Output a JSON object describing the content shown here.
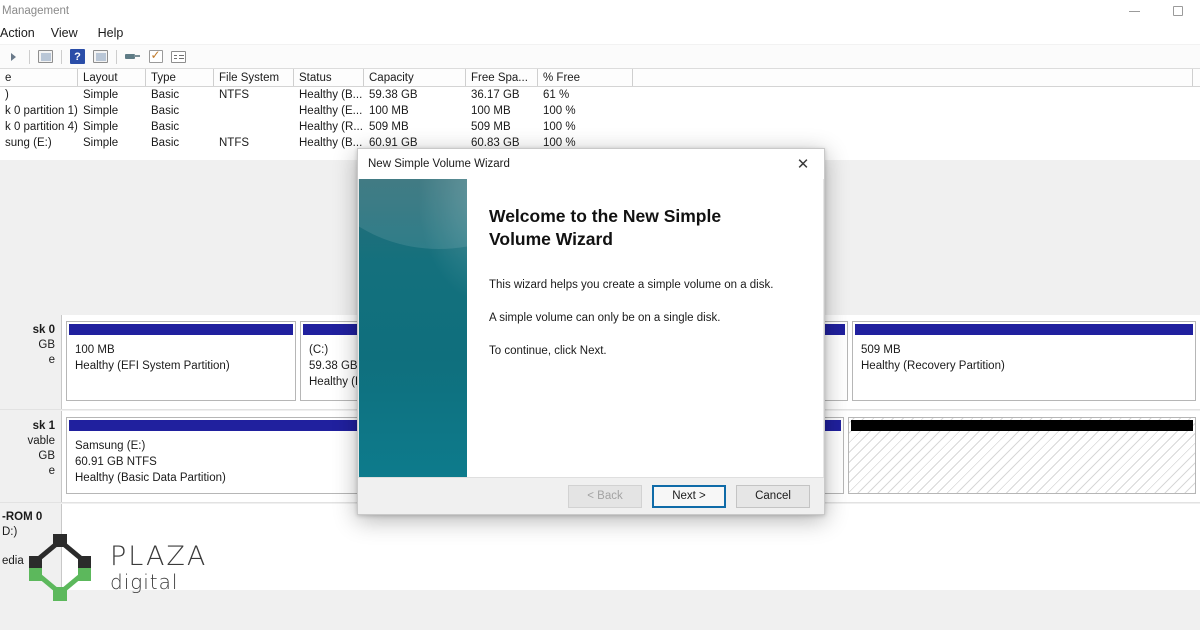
{
  "window": {
    "title": "Management",
    "minimize_label": "Minimize",
    "restore_label": "Restore"
  },
  "menubar": {
    "items": [
      {
        "label": "Action"
      },
      {
        "label": "View"
      },
      {
        "label": "Help"
      }
    ]
  },
  "toolbar": {
    "icons": [
      "forward-arrow-icon",
      "properties-icon",
      "help-icon",
      "rescan-disks-icon",
      "pin-icon",
      "checkmark-icon",
      "list-view-icon"
    ],
    "help_glyph": "?"
  },
  "volume_table": {
    "columns": [
      {
        "key": "volume",
        "label": "e"
      },
      {
        "key": "layout",
        "label": "Layout"
      },
      {
        "key": "type",
        "label": "Type"
      },
      {
        "key": "filesystem",
        "label": "File System"
      },
      {
        "key": "status",
        "label": "Status"
      },
      {
        "key": "capacity",
        "label": "Capacity"
      },
      {
        "key": "freespace",
        "label": "Free Spa..."
      },
      {
        "key": "pctfree",
        "label": "% Free"
      },
      {
        "key": "tail",
        "label": ""
      }
    ],
    "rows": [
      {
        "volume": ")",
        "layout": "Simple",
        "type": "Basic",
        "filesystem": "NTFS",
        "status": "Healthy (B...",
        "capacity": "59.38 GB",
        "freespace": "36.17 GB",
        "pctfree": "61 %"
      },
      {
        "volume": "k 0 partition 1)",
        "layout": "Simple",
        "type": "Basic",
        "filesystem": "",
        "status": "Healthy (E...",
        "capacity": "100 MB",
        "freespace": "100 MB",
        "pctfree": "100 %"
      },
      {
        "volume": "k 0 partition 4)",
        "layout": "Simple",
        "type": "Basic",
        "filesystem": "",
        "status": "Healthy (R...",
        "capacity": "509 MB",
        "freespace": "509 MB",
        "pctfree": "100 %"
      },
      {
        "volume": "sung (E:)",
        "layout": "Simple",
        "type": "Basic",
        "filesystem": "NTFS",
        "status": "Healthy (B...",
        "capacity": "60.91 GB",
        "freespace": "60.83 GB",
        "pctfree": "100 %"
      }
    ]
  },
  "disks": {
    "disk0": {
      "name": "sk 0",
      "size": "GB",
      "state": "e",
      "partitions": [
        {
          "label": "",
          "size": "100 MB",
          "status": "Healthy (EFI System Partition)",
          "bar": "blue"
        },
        {
          "label": "(C:)",
          "size": "59.38 GB NT",
          "status": "Healthy (Bo",
          "bar": "blue"
        },
        {
          "label": "",
          "size": "509 MB",
          "status": "Healthy (Recovery Partition)",
          "bar": "blue"
        }
      ]
    },
    "disk1": {
      "name": "sk 1",
      "type": "vable",
      "size": "GB",
      "state": "e",
      "partitions": [
        {
          "label": "Samsung  (E:)",
          "size": "60.91 GB NTFS",
          "status": "Healthy (Basic Data Partition)",
          "bar": "blue"
        },
        {
          "label": "",
          "size": "",
          "status": "",
          "bar": "black"
        }
      ]
    },
    "cdrom": {
      "name": "-ROM 0",
      "letter": "D:)",
      "state": "edia"
    }
  },
  "dialog": {
    "title": "New Simple Volume Wizard",
    "close_glyph": "✕",
    "heading": "Welcome to the New Simple Volume Wizard",
    "paragraphs": [
      "This wizard helps you create a simple volume on a disk.",
      "A simple volume can only be on a single disk.",
      "To continue, click Next."
    ],
    "buttons": {
      "back": "< Back",
      "next": "Next >",
      "cancel": "Cancel"
    }
  },
  "logo": {
    "primary": "PLAZA",
    "secondary": "digital",
    "colors": {
      "black": "#2b2b2b",
      "green": "#5cb85c"
    }
  },
  "colors": {
    "partition_bar": "#20209e",
    "unallocated_bar": "#000000",
    "wizard_sidebar": "#0f6f7d",
    "focus_border": "#0f6ba8"
  }
}
